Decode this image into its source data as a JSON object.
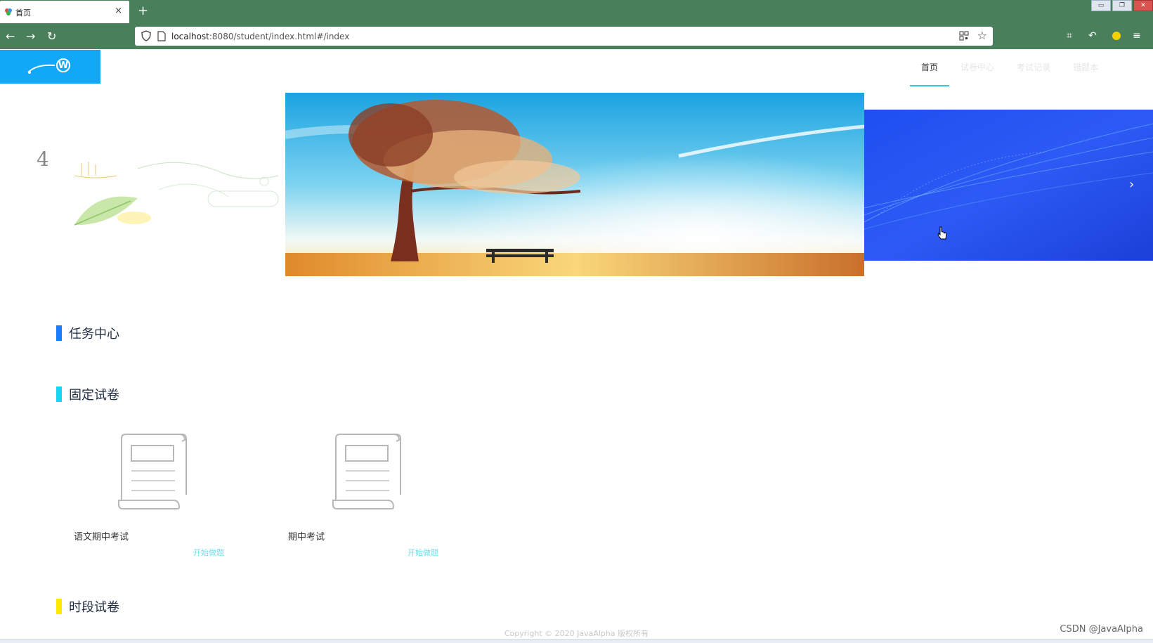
{
  "browser": {
    "tab_title": "首页",
    "tab_close": "×",
    "new_tab": "+",
    "url_host": "localhost",
    "url_rest": ":8080/student/index.html#/index"
  },
  "header": {
    "nav": [
      {
        "label": "首页",
        "active": true
      },
      {
        "label": "试卷中心",
        "active": false
      },
      {
        "label": "考试记录",
        "active": false
      },
      {
        "label": "错题本",
        "active": false
      }
    ]
  },
  "carousel": {
    "left_number": "4",
    "next_glyph": "›"
  },
  "sections": {
    "task_center": {
      "title": "任务中心",
      "accent": "#1a7cff"
    },
    "fixed_papers": {
      "title": "固定试卷",
      "accent": "#17d6f2",
      "items": [
        {
          "name": "语文期中考试",
          "action": "开始做题"
        },
        {
          "name": "期中考试",
          "action": "开始做题"
        }
      ]
    },
    "timed_papers": {
      "title": "时段试卷",
      "accent": "#ffeb00"
    }
  },
  "footer": {
    "copyright": "Copyright © 2020 JavaAlpha 版权所有"
  },
  "watermark": "CSDN @JavaAlpha",
  "colors": {
    "browser_chrome": "#4a7f5c",
    "logo_bg": "#11a8f7",
    "nav_active_underline": "#2ec7e6",
    "link": "#6fe0ee"
  },
  "icons": [
    "tab-favicon-icon",
    "back-icon",
    "forward-icon",
    "reload-icon",
    "shield-icon",
    "page-icon",
    "qr-code-icon",
    "star-icon",
    "screenshot-icon",
    "undo-icon",
    "extension-icon",
    "menu-icon",
    "exam-paper-icon",
    "chevron-right-icon"
  ]
}
